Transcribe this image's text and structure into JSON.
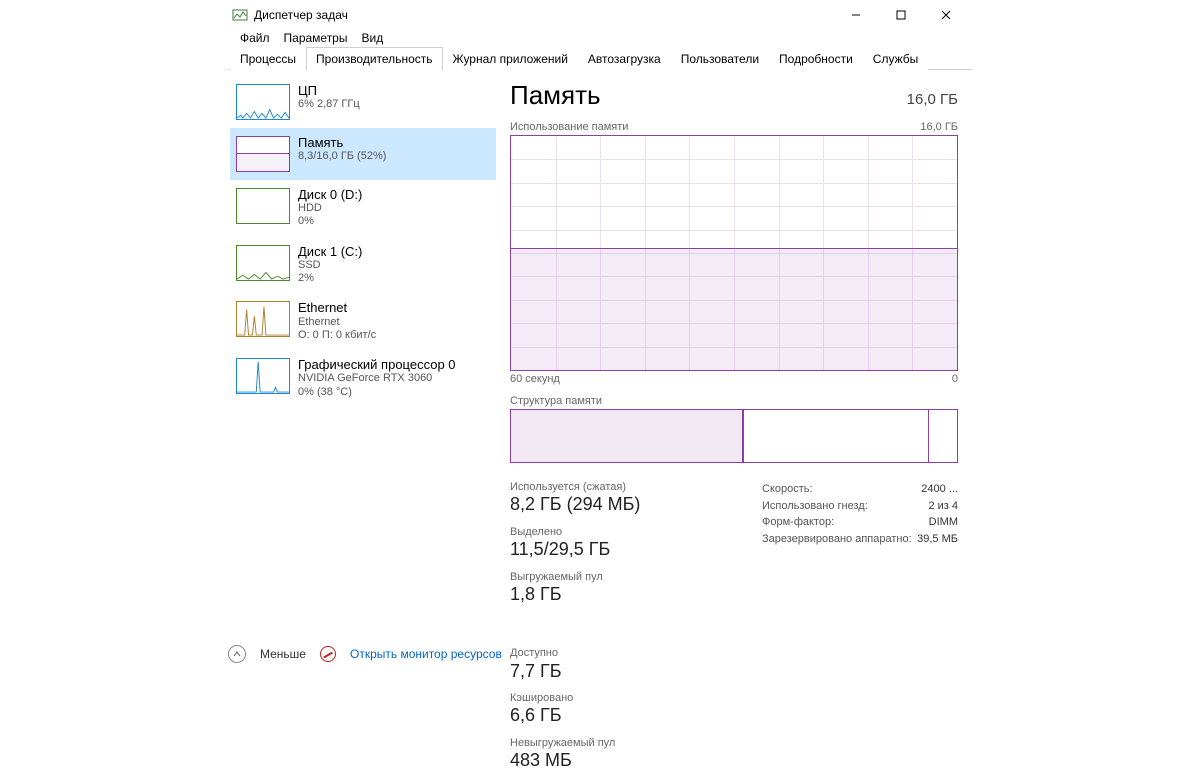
{
  "window": {
    "title": "Диспетчер задач"
  },
  "menu": {
    "file": "Файл",
    "options": "Параметры",
    "view": "Вид"
  },
  "tabs": {
    "processes": "Процессы",
    "performance": "Производительность",
    "appHistory": "Журнал приложений",
    "startup": "Автозагрузка",
    "users": "Пользователи",
    "details": "Подробности",
    "services": "Службы"
  },
  "sidebar": {
    "cpu": {
      "title": "ЦП",
      "sub": "6%  2,87 ГГц"
    },
    "memory": {
      "title": "Память",
      "sub": "8,3/16,0 ГБ (52%)"
    },
    "disk0": {
      "title": "Диск 0 (D:)",
      "sub1": "HDD",
      "sub2": "0%"
    },
    "disk1": {
      "title": "Диск 1 (C:)",
      "sub1": "SSD",
      "sub2": "2%"
    },
    "ethernet": {
      "title": "Ethernet",
      "sub1": "Ethernet",
      "sub2": "О: 0  П: 0 кбит/с"
    },
    "gpu": {
      "title": "Графический процессор 0",
      "sub1": "NVIDIA GeForce RTX 3060",
      "sub2": "0% (38 °C)"
    }
  },
  "main": {
    "title": "Память",
    "capacity": "16,0 ГБ",
    "graphLabel": "Использование памяти",
    "graphMax": "16,0 ГБ",
    "axisLeft": "60 секунд",
    "axisRight": "0",
    "compLabel": "Структура памяти",
    "stats": {
      "usedLbl": "Используется (сжатая)",
      "usedVal": "8,2 ГБ (294 МБ)",
      "availLbl": "Доступно",
      "availVal": "7,7 ГБ",
      "commitLbl": "Выделено",
      "commitVal": "11,5/29,5 ГБ",
      "cachedLbl": "Кэшировано",
      "cachedVal": "6,6 ГБ",
      "pagedLbl": "Выгружаемый пул",
      "pagedVal": "1,8 ГБ",
      "nonpagedLbl": "Невыгружаемый пул",
      "nonpagedVal": "483 МБ"
    },
    "info": {
      "speedLbl": "Скорость:",
      "speedVal": "2400 ...",
      "slotsLbl": "Использовано гнезд:",
      "slotsVal": "2 из 4",
      "formLbl": "Форм-фактор:",
      "formVal": "DIMM",
      "reservedLbl": "Зарезервировано аппаратно:",
      "reservedVal": "39,5 МБ"
    }
  },
  "footer": {
    "less": "Меньше",
    "resmon": "Открыть монитор ресурсов"
  },
  "chart_data": {
    "type": "area",
    "title": "Использование памяти",
    "xlabel": "60 секунд",
    "ylabel": "ГБ",
    "ylim": [
      0,
      16.0
    ],
    "x_range_seconds": [
      60,
      0
    ],
    "series": [
      {
        "name": "Память",
        "approx_constant_value_gb": 8.3,
        "color": "#8e3ea8"
      }
    ]
  }
}
